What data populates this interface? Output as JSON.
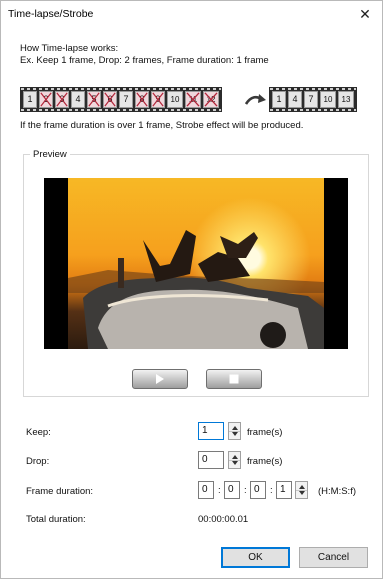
{
  "window": {
    "title": "Time-lapse/Strobe",
    "close_symbol": "✕"
  },
  "intro": {
    "line1": "How Time-lapse works:",
    "line2": "Ex. Keep 1 frame, Drop: 2 frames, Frame duration: 1 frame"
  },
  "illustration": {
    "input_frames": [
      {
        "n": "1",
        "dropped": false
      },
      {
        "n": "2",
        "dropped": true
      },
      {
        "n": "3",
        "dropped": true
      },
      {
        "n": "4",
        "dropped": false
      },
      {
        "n": "5",
        "dropped": true
      },
      {
        "n": "6",
        "dropped": true
      },
      {
        "n": "7",
        "dropped": false
      },
      {
        "n": "8",
        "dropped": true
      },
      {
        "n": "9",
        "dropped": true
      },
      {
        "n": "10",
        "dropped": false
      },
      {
        "n": "11",
        "dropped": true
      },
      {
        "n": "12",
        "dropped": true
      }
    ],
    "output_frames": [
      "1",
      "4",
      "7",
      "10",
      "13"
    ]
  },
  "note": "If the frame duration is over 1 frame, Strobe effect will be produced.",
  "preview": {
    "label": "Preview"
  },
  "fields": {
    "keep": {
      "label": "Keep:",
      "value": "1",
      "unit": "frame(s)"
    },
    "drop": {
      "label": "Drop:",
      "value": "0",
      "unit": "frame(s)"
    },
    "frame_duration": {
      "label": "Frame duration:",
      "h": "0",
      "m": "0",
      "s": "0",
      "f": "1",
      "sep": ":",
      "unit": "(H:M:S:f)"
    },
    "total_duration": {
      "label": "Total duration:",
      "value": "00:00:00.01"
    }
  },
  "buttons": {
    "ok": "OK",
    "cancel": "Cancel"
  },
  "colors": {
    "focus_blue": "#0078d7",
    "drop_frame": "#f0d7dc",
    "button_face": "#e1e1e1"
  }
}
